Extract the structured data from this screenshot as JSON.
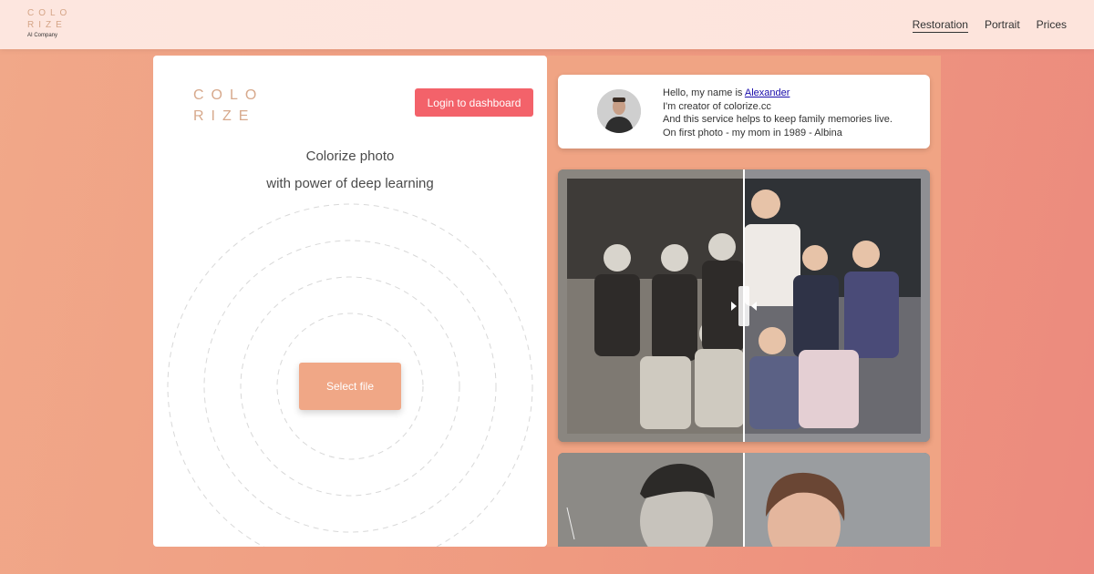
{
  "header": {
    "brand_line1": "COLO",
    "brand_line2": "RIZE",
    "brand_sub": "AI Company",
    "nav": [
      "Restoration",
      "Portrait",
      "Prices"
    ]
  },
  "left_card": {
    "logo_line1": "COLO",
    "logo_line2": "RIZE",
    "login_label": "Login to dashboard",
    "tagline1": "Colorize photo",
    "tagline2": "with power of deep learning",
    "select_label": "Select file"
  },
  "intro": {
    "line1_prefix": "Hello, my name is ",
    "line1_link": "Alexander",
    "line2": "I'm creator of colorize.cc",
    "line3": "And this service helps to keep family memories live.",
    "line4": "On first photo - my mom in 1989 -  Albina"
  },
  "colors": {
    "accent_red": "#f3626a",
    "accent_peach": "#f0a786",
    "logo_tan": "#d7a98c"
  },
  "icons": {
    "slider_handle": "double-chevron-slider-icon"
  }
}
